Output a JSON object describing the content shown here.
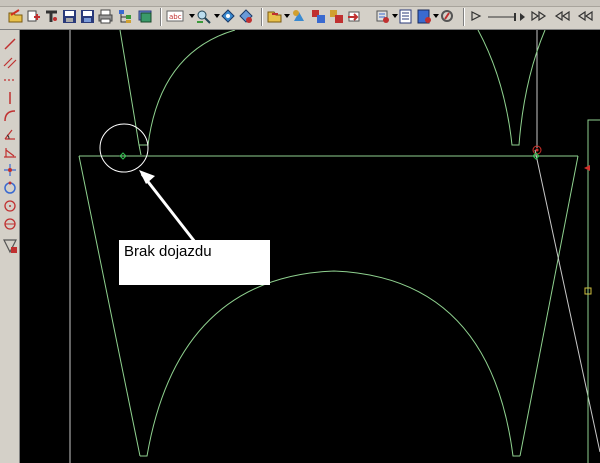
{
  "annotation": {
    "text": "Brak dojazdu"
  },
  "colors": {
    "background": "#000000",
    "geometry": "#8fd18f",
    "guide_line": "#c8c8c8",
    "marker_green": "#2fbf4f",
    "marker_red": "#d0302a",
    "toolbar": "#d4d0c8"
  },
  "toolbar": {
    "icons": [
      "open-file-icon",
      "import-icon",
      "tool-icon",
      "save-icon",
      "save-as-icon",
      "print-icon",
      "hierarchy-icon",
      "layers-icon",
      "filter-icon",
      "zoom-icon",
      "pan-icon",
      "view-icon",
      "move-icon",
      "copy-icon",
      "insert-icon",
      "table-icon",
      "export-icon",
      "clear-icon",
      "properties-icon",
      "play-icon",
      "step-forward-icon",
      "rewind-icon",
      "first-icon"
    ]
  },
  "sidebar": {
    "icons": [
      "line-tool-icon",
      "parallel-line-icon",
      "dashed-line-icon",
      "vertical-line-icon",
      "arc-tool-icon",
      "angle-tool-icon",
      "dimension-icon",
      "crosshair-icon",
      "rotate-icon",
      "circle-tool-icon",
      "circle-center-icon",
      "trim-tool-icon"
    ]
  }
}
